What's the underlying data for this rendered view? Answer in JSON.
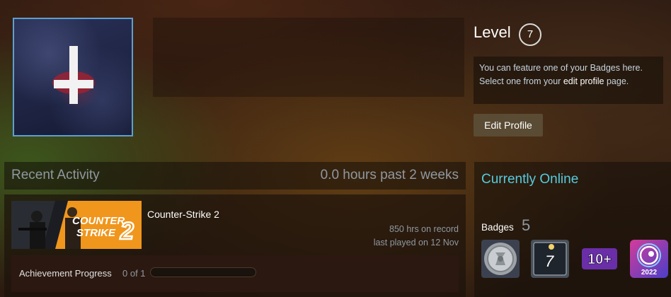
{
  "profile": {
    "level_label": "Level",
    "level_value": "7",
    "badge_notice_line1": "You can feature one of your Badges here.",
    "badge_notice_pre": "Select one from your ",
    "badge_notice_link": "edit profile",
    "badge_notice_post": " page.",
    "edit_profile_label": "Edit Profile"
  },
  "recent_activity": {
    "title": "Recent Activity",
    "hours_summary": "0.0 hours past 2 weeks",
    "game": {
      "name": "Counter-Strike 2",
      "capsule_line1": "COUNTER",
      "capsule_line2": "STRIKE",
      "capsule_number": "2",
      "hours_on_record": "850 hrs on record",
      "last_played": "last played on 12 Nov",
      "achievement_label": "Achievement Progress",
      "achievement_count": "0 of 1",
      "achievement_progress": 0
    }
  },
  "status": {
    "online_label": "Currently Online"
  },
  "badges": {
    "label": "Badges",
    "count": "5",
    "items": [
      {
        "icon": "silver-coin-badge-icon"
      },
      {
        "icon": "years-of-service-7-badge-icon",
        "text": "7"
      },
      {
        "icon": "ten-plus-badge-icon",
        "text": "10+"
      },
      {
        "icon": "steam-replay-2022-badge-icon",
        "text": "2022"
      }
    ]
  },
  "colors": {
    "accent_online": "#57cbde",
    "edit_button": "#5a4b34",
    "avatar_border": "#5e9fd0"
  }
}
